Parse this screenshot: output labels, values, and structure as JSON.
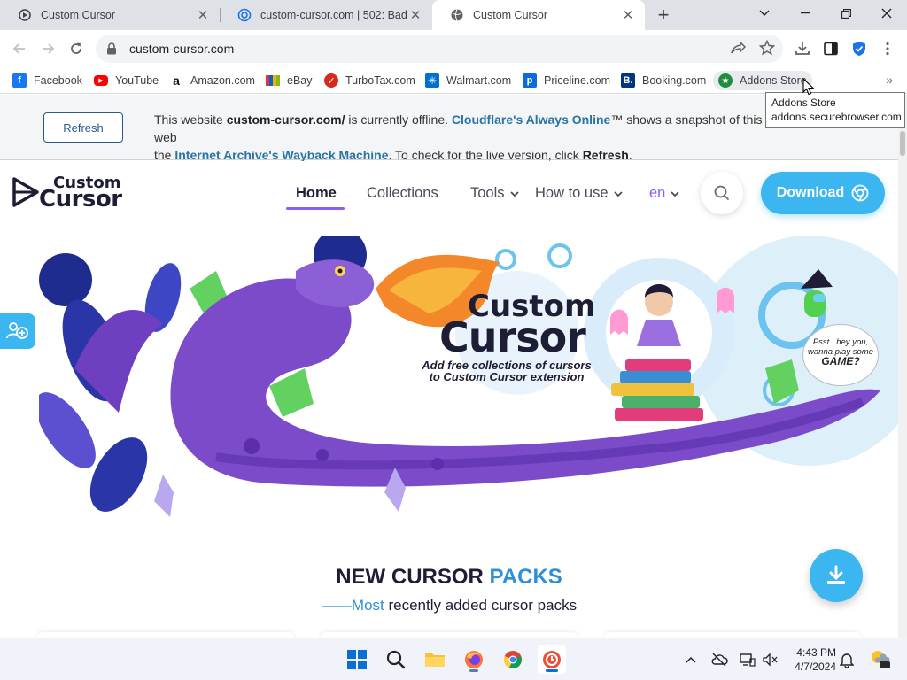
{
  "browser": {
    "tabs": [
      {
        "title": "Custom Cursor",
        "active": false
      },
      {
        "title": "custom-cursor.com | 502: Bad ga",
        "active": false
      },
      {
        "title": "Custom Cursor",
        "active": true
      }
    ],
    "url": "custom-cursor.com",
    "bookmarks": [
      {
        "label": "Facebook",
        "icon": "facebook-icon",
        "color": "#1877f2"
      },
      {
        "label": "YouTube",
        "icon": "youtube-icon",
        "color": "#ff0000"
      },
      {
        "label": "Amazon.com",
        "icon": "amazon-icon",
        "color": "#111111"
      },
      {
        "label": "eBay",
        "icon": "ebay-icon",
        "color": "#e53238"
      },
      {
        "label": "TurboTax.com",
        "icon": "turbotax-icon",
        "color": "#d52b1e"
      },
      {
        "label": "Walmart.com",
        "icon": "walmart-icon",
        "color": "#0071ce"
      },
      {
        "label": "Priceline.com",
        "icon": "priceline-icon",
        "color": "#0a6cdb"
      },
      {
        "label": "Booking.com",
        "icon": "booking-icon",
        "color": "#003580"
      },
      {
        "label": "Addons Store",
        "icon": "addons-store-icon",
        "color": "#1e8e3e"
      }
    ],
    "tooltip": {
      "line1": "Addons Store",
      "line2": "addons.securebrowser.com"
    }
  },
  "banner": {
    "refresh_label": "Refresh",
    "text_1": "This website ",
    "site": "custom-cursor.com/",
    "text_2": " is currently offline. ",
    "link_1": "Cloudflare's Always Online",
    "tm": "™",
    "text_3": " shows a snapshot of this web",
    "text_4": "the ",
    "link_2": "Internet Archive's Wayback Machine",
    "text_5": ". To check for the live version, click ",
    "refresh_word": "Refresh",
    "text_6": "."
  },
  "site": {
    "logo_top": "Custom",
    "logo_bottom": "Cursor",
    "nav": {
      "home": "Home",
      "collections": "Collections",
      "tools": "Tools",
      "how_to_use": "How to use",
      "lang": "en"
    },
    "download_label": "Download",
    "hero": {
      "title_1": "Custom",
      "title_2": "Cursor",
      "subtitle_1": "Add free collections of cursors",
      "subtitle_2": "to Custom Cursor extension",
      "bubble_1": "Psst.. hey you,",
      "bubble_2": "wanna play some",
      "bubble_3": "GAME?"
    },
    "section": {
      "title_1": "NEW CURSOR ",
      "title_2": "PACKS",
      "sub_dash": "——",
      "sub_accent": "Most",
      "sub_rest": " recently added cursor packs"
    },
    "colors": {
      "accent": "#3cb6f0",
      "purple": "#8b5cf6",
      "dark": "#1d1d35"
    }
  },
  "taskbar": {
    "time": "4:43 PM",
    "date": "4/7/2024"
  }
}
